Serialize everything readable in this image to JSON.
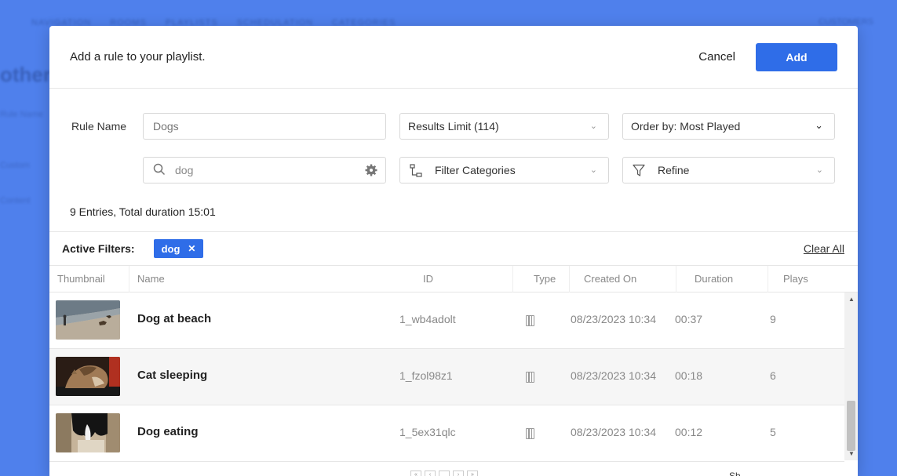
{
  "background": {
    "nav_items": [
      "NAVIGATION",
      "ROOMS",
      "PLAYLISTS",
      "SCHEDULATION",
      "CATEGORIES"
    ],
    "nav_right": "CUSTOMERS",
    "title": "other",
    "side_items": [
      "Rule Name",
      "Custom",
      "Content"
    ]
  },
  "modal": {
    "title": "Add a rule to your playlist.",
    "cancel_label": "Cancel",
    "add_label": "Add"
  },
  "form": {
    "rule_name_label": "Rule Name",
    "rule_name_placeholder": "Dogs",
    "results_limit": "Results Limit (114)",
    "order_by": "Order by: Most Played",
    "search_value": "dog",
    "filter_categories": "Filter Categories",
    "refine": "Refine"
  },
  "summary": "9 Entries, Total duration 15:01",
  "filters": {
    "label": "Active Filters:",
    "chips": [
      {
        "label": "dog"
      }
    ],
    "clear_all": "Clear All"
  },
  "table": {
    "headers": [
      "Thumbnail",
      "Name",
      "ID",
      "Type",
      "Created On",
      "Duration",
      "Plays"
    ],
    "rows": [
      {
        "name": "Dog at beach",
        "id": "1_wb4adolt",
        "type": "video-icon",
        "created": "08/23/2023 10:34",
        "duration": "00:37",
        "plays": "9"
      },
      {
        "name": "Cat sleeping",
        "id": "1_fzol98z1",
        "type": "video-icon",
        "created": "08/23/2023 10:34",
        "duration": "00:18",
        "plays": "6"
      },
      {
        "name": "Dog eating",
        "id": "1_5ex31qlc",
        "type": "video-icon",
        "created": "08/23/2023 10:34",
        "duration": "00:12",
        "plays": "5"
      }
    ]
  },
  "footer": {
    "show_label": "Sh"
  },
  "colors": {
    "accent": "#2f6de8",
    "background": "#4f80ec"
  }
}
